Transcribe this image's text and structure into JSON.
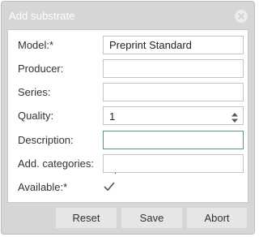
{
  "dialog": {
    "title": "Add substrate"
  },
  "form": {
    "model": {
      "label": "Model:*",
      "value": "Preprint Standard"
    },
    "producer": {
      "label": "Producer:",
      "value": ""
    },
    "series": {
      "label": "Series:",
      "value": ""
    },
    "quality": {
      "label": "Quality:",
      "value": "1"
    },
    "description": {
      "label": "Description:",
      "value": ""
    },
    "add_categories": {
      "label": "Add. categories:",
      "value": ""
    },
    "available": {
      "label": "Available:*",
      "checked": true
    }
  },
  "footer": {
    "reset_label": "Reset",
    "save_label": "Save",
    "abort_label": "Abort"
  },
  "icons": {
    "close": "close-icon",
    "spinner": "spin-arrows-icon",
    "check": "check-icon"
  },
  "colors": {
    "titlebar": "#d6d6d6",
    "focus_border": "#5b8e8e",
    "button_bg": "#e6e6e6"
  }
}
